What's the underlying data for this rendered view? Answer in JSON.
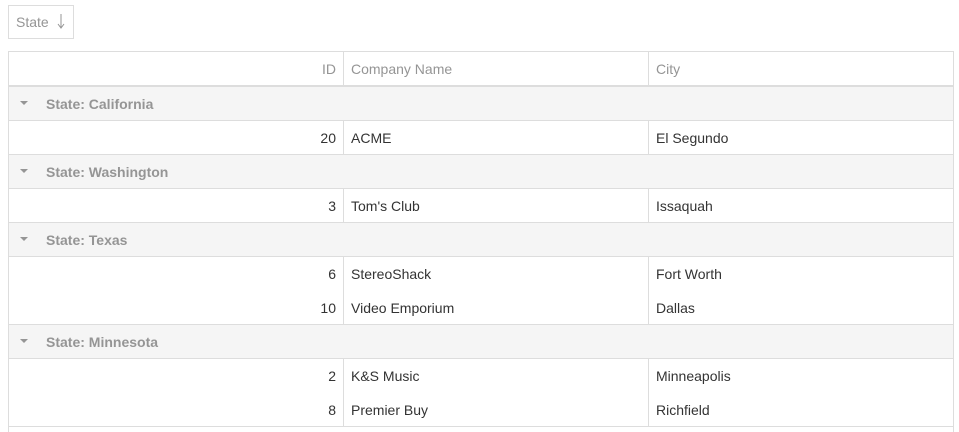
{
  "group_panel": {
    "chip_label": "State",
    "sort_icon": "sort-arrow-down-icon"
  },
  "columns": {
    "id": "ID",
    "company": "Company Name",
    "city": "City"
  },
  "groups": [
    {
      "label": "State: California",
      "rows": [
        {
          "id": "20",
          "company": "ACME",
          "city": "El Segundo"
        }
      ]
    },
    {
      "label": "State: Washington",
      "rows": [
        {
          "id": "3",
          "company": "Tom's Club",
          "city": "Issaquah"
        }
      ]
    },
    {
      "label": "State: Texas",
      "rows": [
        {
          "id": "6",
          "company": "StereoShack",
          "city": "Fort Worth"
        },
        {
          "id": "10",
          "company": "Video Emporium",
          "city": "Dallas"
        }
      ]
    },
    {
      "label": "State: Minnesota",
      "rows": [
        {
          "id": "2",
          "company": "K&S Music",
          "city": "Minneapolis"
        },
        {
          "id": "8",
          "company": "Premier Buy",
          "city": "Richfield"
        }
      ]
    }
  ]
}
